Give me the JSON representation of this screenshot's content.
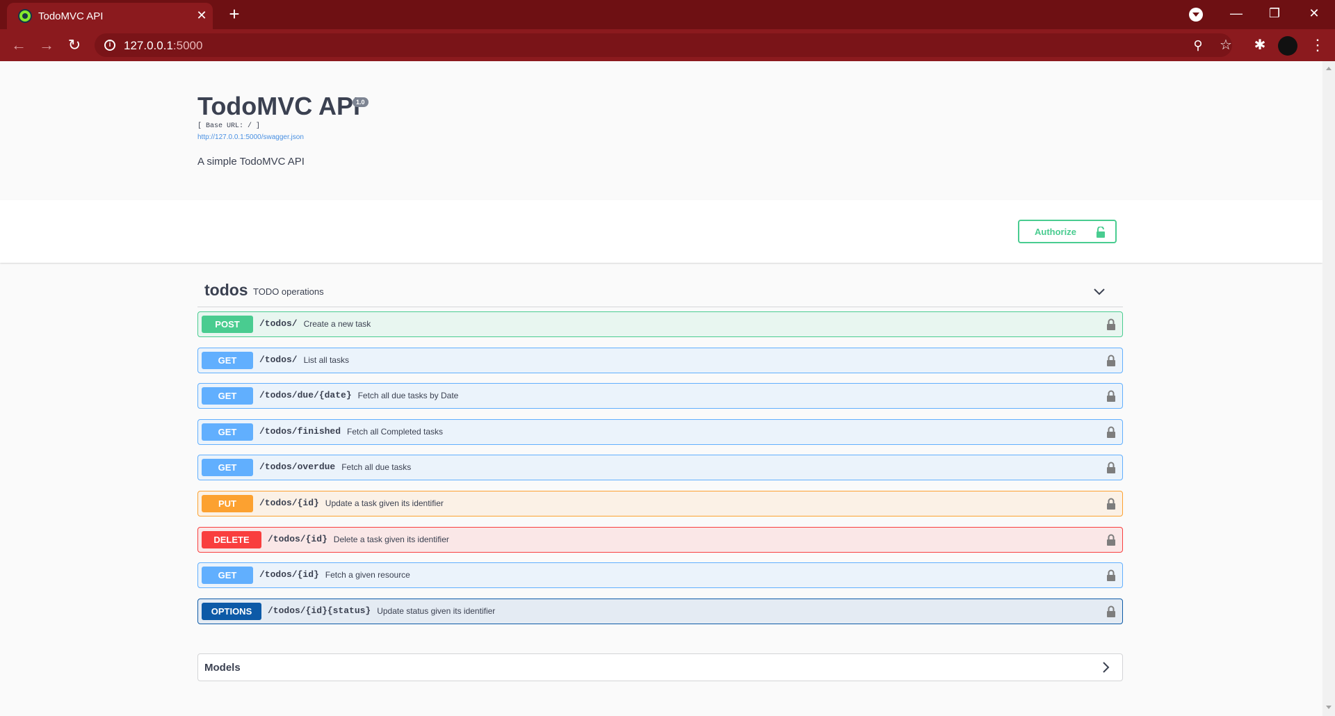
{
  "browser": {
    "tab_title": "TodoMVC API",
    "url_host": "127.0.0.1",
    "url_port": ":5000"
  },
  "info": {
    "title": "TodoMVC API",
    "version": "1.0",
    "base_url": "[ Base URL: / ]",
    "json_link": "http://127.0.0.1:5000/swagger.json",
    "description": "A simple TodoMVC API"
  },
  "auth": {
    "label": "Authorize"
  },
  "tag": {
    "name": "todos",
    "description": "TODO operations"
  },
  "operations": [
    {
      "method": "POST",
      "path": "/todos/",
      "summary": "Create a new task",
      "color": "#49cc90",
      "bg": "#e8f6f0"
    },
    {
      "method": "GET",
      "path": "/todos/",
      "summary": "List all tasks",
      "color": "#61affe",
      "bg": "#ebf3fb"
    },
    {
      "method": "GET",
      "path": "/todos/due/{date}",
      "summary": "Fetch all due tasks by Date",
      "color": "#61affe",
      "bg": "#ebf3fb"
    },
    {
      "method": "GET",
      "path": "/todos/finished",
      "summary": "Fetch all Completed tasks",
      "color": "#61affe",
      "bg": "#ebf3fb"
    },
    {
      "method": "GET",
      "path": "/todos/overdue",
      "summary": "Fetch all due tasks",
      "color": "#61affe",
      "bg": "#ebf3fb"
    },
    {
      "method": "PUT",
      "path": "/todos/{id}",
      "summary": "Update a task given its identifier",
      "color": "#fca130",
      "bg": "#fbf1e6"
    },
    {
      "method": "DELETE",
      "path": "/todos/{id}",
      "summary": "Delete a task given its identifier",
      "color": "#f93e3e",
      "bg": "#fae7e7"
    },
    {
      "method": "GET",
      "path": "/todos/{id}",
      "summary": "Fetch a given resource",
      "color": "#61affe",
      "bg": "#ebf3fb"
    },
    {
      "method": "OPTIONS",
      "path": "/todos/{id}{status}",
      "summary": "Update status given its identifier",
      "color": "#0d5aa7",
      "bg": "#e4ebf3"
    }
  ],
  "models": {
    "title": "Models"
  }
}
